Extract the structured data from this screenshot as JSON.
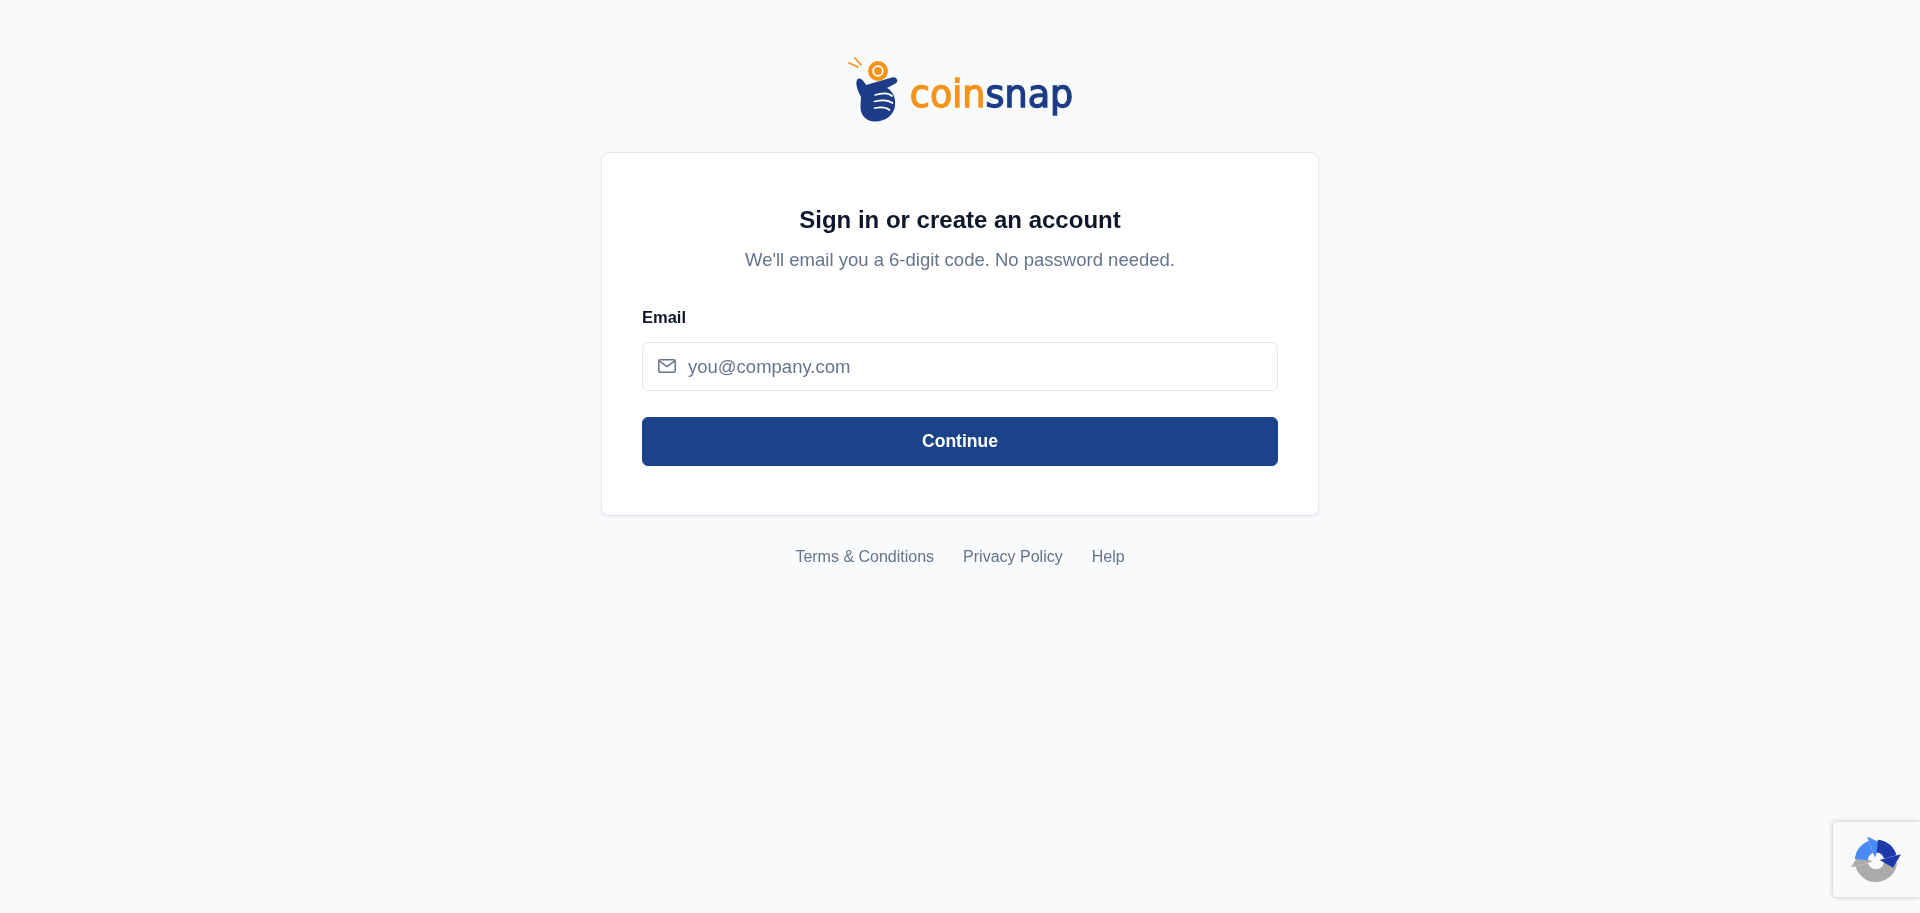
{
  "logo": {
    "wordmark": [
      {
        "text": "coin",
        "color": "#f7931a"
      },
      {
        "text": "snap",
        "color": "#1d3c87"
      }
    ]
  },
  "card": {
    "title": "Sign in or create an account",
    "subtitle": "We'll email you a 6-digit code. No password needed.",
    "email_field": {
      "label": "Email",
      "placeholder": "you@company.com"
    },
    "button": "Continue"
  },
  "footer_links": [
    "Terms & Conditions",
    "Privacy Policy",
    "Help"
  ]
}
